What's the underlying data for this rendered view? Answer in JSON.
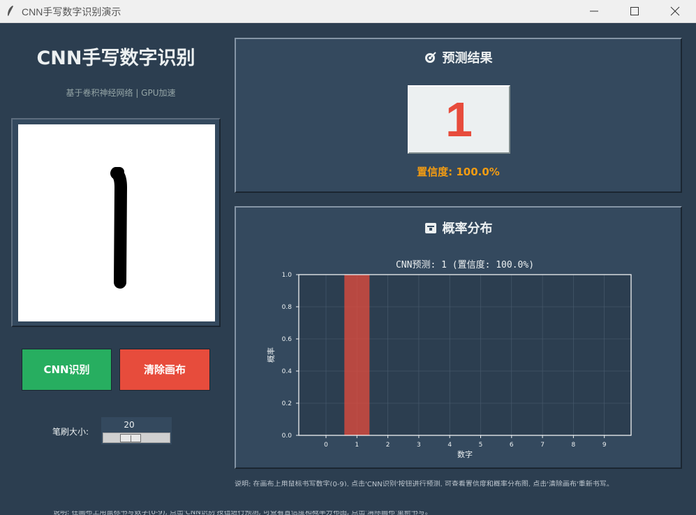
{
  "window": {
    "title": "CNN手写数字识别演示",
    "controls": [
      "minimize",
      "maximize",
      "close"
    ]
  },
  "left": {
    "title": "CNN手写数字识别",
    "subtitle": "基于卷积神经网络 | GPU加速",
    "recognize_button": "CNN识别",
    "clear_button": "清除画布",
    "brush_label": "笔刷大小:",
    "brush_size": "20",
    "brush_min": 1,
    "brush_max": 50
  },
  "result_panel": {
    "icon": "target-icon",
    "title": "预测结果",
    "predicted_digit": "1",
    "confidence_text": "置信度: 100.0%"
  },
  "prob_panel": {
    "icon": "box-icon",
    "title": "概率分布"
  },
  "chart_data": {
    "type": "bar",
    "title": "CNN预测: 1 (置信度: 100.0%)",
    "xlabel": "数字",
    "ylabel": "概率",
    "categories": [
      "0",
      "1",
      "2",
      "3",
      "4",
      "5",
      "6",
      "7",
      "8",
      "9"
    ],
    "values": [
      0.0,
      1.0,
      0.0,
      0.0,
      0.0,
      0.0,
      0.0,
      0.0,
      0.0,
      0.0
    ],
    "yticks": [
      "0.0",
      "0.2",
      "0.4",
      "0.6",
      "0.8",
      "1.0"
    ],
    "ylim": [
      0,
      1.0
    ],
    "grid": true,
    "colors": {
      "highlight": "#e74c3c",
      "other": "#3498db",
      "background": "#2c3e50"
    }
  },
  "footer": {
    "hint": "说明: 在画布上用鼠标书写数字(0-9), 点击'CNN识别'按钮进行预测, 可查看置信度和概率分布图, 点击'清除画布'重新书写。"
  }
}
